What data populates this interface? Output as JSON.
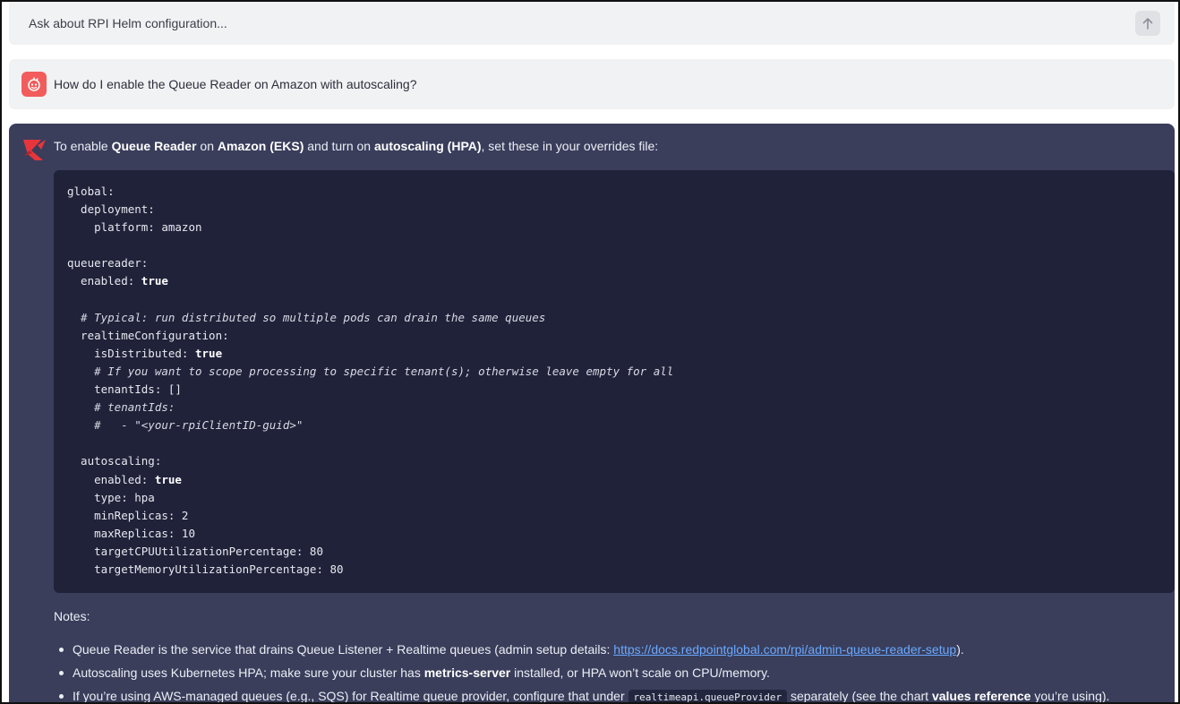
{
  "ask_bar": {
    "placeholder": "Ask about RPI Helm configuration...",
    "send_icon": "arrow-up-icon"
  },
  "user_message": {
    "avatar_icon": "user-avatar-icon",
    "text": "How do I enable the Queue Reader on Amazon with autoscaling?"
  },
  "assistant": {
    "icon": "redpoint-logo-icon",
    "intro": {
      "t1": "To enable ",
      "b1": "Queue Reader",
      "t2": " on ",
      "b2": "Amazon (EKS)",
      "t3": " and turn on ",
      "b3": "autoscaling (HPA)",
      "t4": ", set these in your overrides file:"
    },
    "code_lines": [
      {
        "text": "global:"
      },
      {
        "text": "  deployment:"
      },
      {
        "text": "    platform: amazon"
      },
      {
        "text": ""
      },
      {
        "text": "queuereader:"
      },
      {
        "text": "  enabled: ",
        "kw": "true"
      },
      {
        "text": ""
      },
      {
        "comment": "  # Typical: run distributed so multiple pods can drain the same queues"
      },
      {
        "text": "  realtimeConfiguration:"
      },
      {
        "text": "    isDistributed: ",
        "kw": "true"
      },
      {
        "comment": "    # If you want to scope processing to specific tenant(s); otherwise leave empty for all"
      },
      {
        "text": "    tenantIds: []"
      },
      {
        "comment": "    # tenantIds:"
      },
      {
        "comment": "    #   - \"<your-rpiClientID-guid>\""
      },
      {
        "text": ""
      },
      {
        "text": "  autoscaling:"
      },
      {
        "text": "    enabled: ",
        "kw": "true"
      },
      {
        "text": "    type: hpa"
      },
      {
        "text": "    minReplicas: 2"
      },
      {
        "text": "    maxReplicas: 10"
      },
      {
        "text": "    targetCPUUtilizationPercentage: 80"
      },
      {
        "text": "    targetMemoryUtilizationPercentage: 80"
      }
    ],
    "notes_label": "Notes:",
    "notes": {
      "n1": {
        "t1": "Queue Reader is the service that drains Queue Listener + Realtime queues (admin setup details: ",
        "link": "https://docs.redpointglobal.com/rpi/admin-queue-reader-setup",
        "t2": ")."
      },
      "n2": {
        "t1": "Autoscaling uses Kubernetes HPA; make sure your cluster has ",
        "b1": "metrics-server",
        "t2": " installed, or HPA won’t scale on CPU/memory."
      },
      "n3": {
        "t1": "If you’re using AWS-managed queues (e.g., SQS) for Realtime queue provider, configure that under ",
        "code": "realtimeapi.queueProvider",
        "t2": " separately (see the chart ",
        "b1": "values reference",
        "t3": " you’re using)."
      }
    }
  }
}
